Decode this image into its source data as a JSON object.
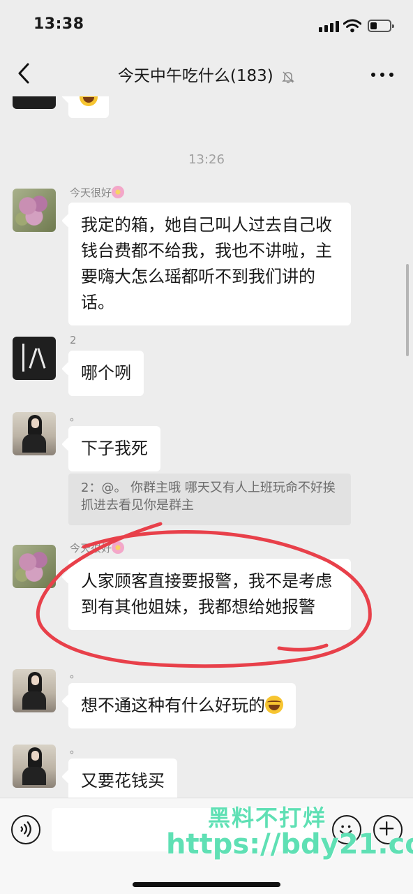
{
  "status_bar": {
    "time": "13:38"
  },
  "header": {
    "title": "今天中午吃什么",
    "member_count": "(183)"
  },
  "chat": {
    "timestamp": "13:26",
    "top_partial_message": {
      "has_emoji": "laugh"
    },
    "messages": [
      {
        "sender": "今天很好",
        "text": "我定的箱，她自己叫人过去自己收钱台费都不给我，我也不讲啦，主要嗨大怎么瑶都听不到我们讲的话。",
        "avatar": "flowers"
      },
      {
        "sender": "2",
        "text": "哪个咧",
        "avatar": "dark"
      },
      {
        "sender": "。",
        "text": "下子我死",
        "avatar": "girl",
        "quote": "2：@。 你群主哦 哪天又有人上班玩命不好挨抓进去看见你是群主"
      },
      {
        "sender": "今天很好",
        "text": "人家顾客直接要报警，我不是考虑到有其他姐妹，我都想给她报警",
        "avatar": "flowers"
      },
      {
        "sender": "。",
        "text": "想不通这种有什么好玩的",
        "avatar": "girl",
        "emoji": "laugh"
      },
      {
        "sender": "。",
        "text": "又要花钱买",
        "avatar": "girl"
      }
    ]
  },
  "watermark": {
    "line1": "黑料不打烊",
    "line2": "https://bdy21.co"
  },
  "colors": {
    "background": "#ededed",
    "bubble": "#ffffff",
    "annotation": "#e8404a",
    "watermark": "#5fe0b4"
  }
}
